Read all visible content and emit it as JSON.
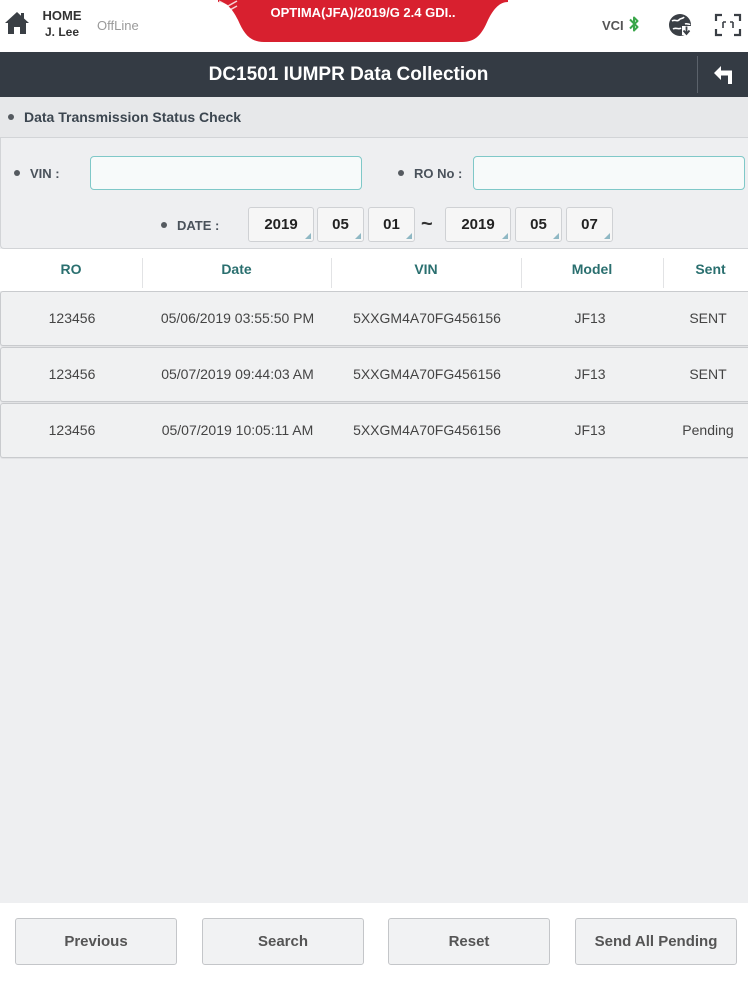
{
  "topbar": {
    "home_label": "HOME",
    "user": "J. Lee",
    "status": "OffLine",
    "vehicle": "OPTIMA(JFA)/2019/G 2.4 GDI..",
    "vci_label": "VCI",
    "colors": {
      "vehicle_tab": "#d8202f",
      "bluetooth": "#3aa64a"
    }
  },
  "title": "DC1501 IUMPR Data Collection",
  "section": {
    "title": "Data Transmission Status Check"
  },
  "filters": {
    "vin_label": "VIN :",
    "vin_value": "",
    "ro_label": "RO No :",
    "ro_value": "",
    "date_label": "DATE :",
    "from": {
      "year": "2019",
      "month": "05",
      "day": "01"
    },
    "separator": "~",
    "to": {
      "year": "2019",
      "month": "05",
      "day": "07"
    }
  },
  "table": {
    "headers": [
      "RO",
      "Date",
      "VIN",
      "Model",
      "Sent"
    ],
    "rows": [
      [
        "123456",
        "05/06/2019 03:55:50 PM",
        "5XXGM4A70FG456156",
        "JF13",
        "SENT"
      ],
      [
        "123456",
        "05/07/2019 09:44:03 AM",
        "5XXGM4A70FG456156",
        "JF13",
        "SENT"
      ],
      [
        "123456",
        "05/07/2019 10:05:11 AM",
        "5XXGM4A70FG456156",
        "JF13",
        "Pending"
      ]
    ]
  },
  "footer": {
    "previous": "Previous",
    "search": "Search",
    "reset": "Reset",
    "send_all": "Send All Pending"
  }
}
